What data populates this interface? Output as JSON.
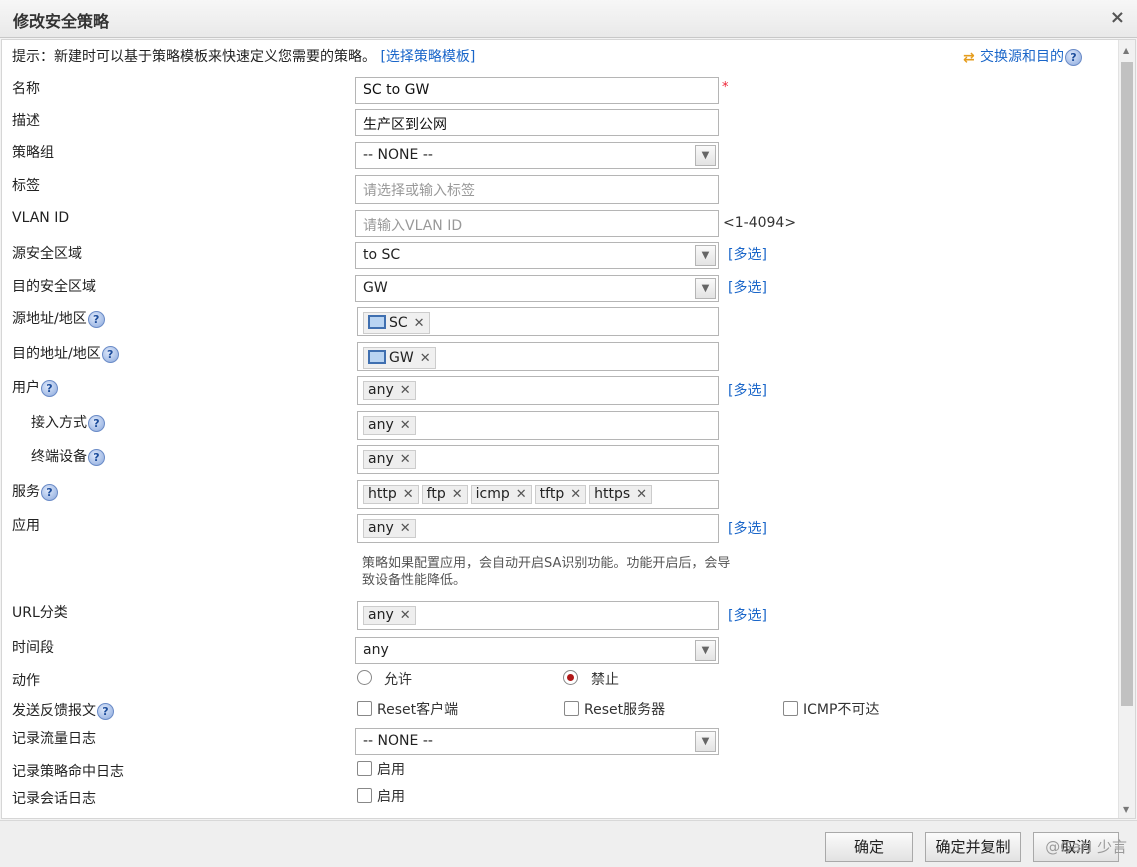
{
  "dialog": {
    "title": "修改安全策略",
    "close_glyph": "×"
  },
  "tip": {
    "text": "提示：新建时可以基于策略模板来快速定义您需要的策略。",
    "template_link": "[选择策略模板]",
    "swap_label": "交换源和目的"
  },
  "fields": {
    "name": {
      "label": "名称",
      "value": "SC to GW",
      "required_mark": "*"
    },
    "desc": {
      "label": "描述",
      "value": "生产区到公网"
    },
    "group": {
      "label": "策略组",
      "value": "-- NONE --"
    },
    "tags": {
      "label": "标签",
      "placeholder": "请选择或输入标签"
    },
    "vlan": {
      "label": "VLAN ID",
      "placeholder": "请输入VLAN ID",
      "range": "<1-4094>"
    },
    "src_zone": {
      "label": "源安全区域",
      "value": "to SC",
      "multi": "[多选]"
    },
    "dst_zone": {
      "label": "目的安全区域",
      "value": "GW",
      "multi": "[多选]"
    },
    "src_addr": {
      "label": "源地址/地区",
      "tag": "SC"
    },
    "dst_addr": {
      "label": "目的地址/地区",
      "tag": "GW"
    },
    "user": {
      "label": "用户",
      "tag": "any",
      "multi": "[多选]"
    },
    "access": {
      "label": "接入方式",
      "tag": "any"
    },
    "device": {
      "label": "终端设备",
      "tag": "any"
    },
    "service": {
      "label": "服务",
      "tags": [
        "http",
        "ftp",
        "icmp",
        "tftp",
        "https"
      ]
    },
    "app": {
      "label": "应用",
      "tag": "any",
      "multi": "[多选]",
      "hint": "策略如果配置应用，会自动开启SA识别功能。功能开启后，会导致设备性能降低。"
    },
    "url": {
      "label": "URL分类",
      "tag": "any",
      "multi": "[多选]"
    },
    "time": {
      "label": "时间段",
      "value": "any"
    },
    "action": {
      "label": "动作",
      "allow": "允许",
      "deny": "禁止",
      "selected": "禁止"
    },
    "feedback": {
      "label": "发送反馈报文",
      "opt1": "Reset客户端",
      "opt2": "Reset服务器",
      "opt3": "ICMP不可达"
    },
    "traffic_log": {
      "label": "记录流量日志",
      "value": "-- NONE --"
    },
    "hit_log": {
      "label": "记录策略命中日志",
      "opt": "启用"
    },
    "session_log": {
      "label": "记录会话日志",
      "opt": "启用"
    }
  },
  "footer": {
    "ok": "确定",
    "ok_copy": "确定并复制",
    "cancel": "取消",
    "watermark": "@GaN 少言"
  },
  "icons": {
    "help": "?",
    "remove": "✕",
    "dropdown": "▼"
  }
}
